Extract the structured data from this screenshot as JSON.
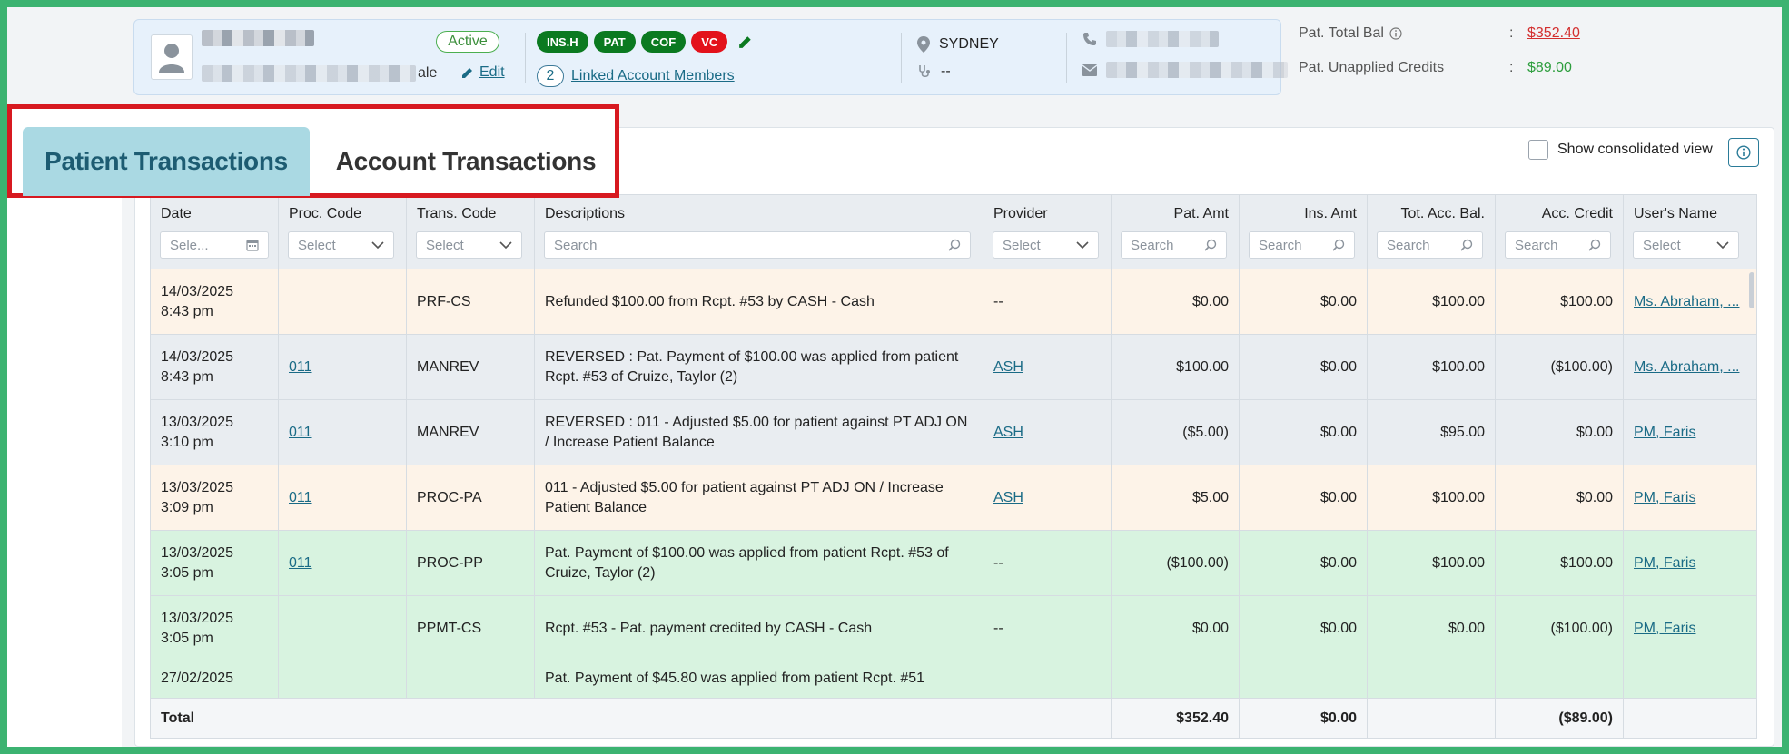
{
  "header": {
    "status": "Active",
    "gender_suffix": "ale",
    "edit_label": "Edit",
    "tags": [
      {
        "label": "INS.H",
        "color": "#0b7a20"
      },
      {
        "label": "PAT",
        "color": "#0b7a20"
      },
      {
        "label": "COF",
        "color": "#0b7a20"
      },
      {
        "label": "VC",
        "color": "#e3121b"
      }
    ],
    "linked_count": "2",
    "linked_label": "Linked Account Members",
    "location": "SYDNEY",
    "doctor": "--",
    "pat_total_bal_label": "Pat. Total Bal",
    "pat_total_bal_value": "$352.40",
    "pat_unapplied_label": "Pat. Unapplied Credits",
    "pat_unapplied_value": "$89.00",
    "colon": ":",
    "colors": {
      "balance_red": "#d32f2f",
      "balance_green": "#2e9e3e",
      "accent": "#1a6b86"
    }
  },
  "tabs": {
    "patient": "Patient Transactions",
    "account": "Account Transactions"
  },
  "consolidated_label": "Show consolidated view",
  "table": {
    "columns": [
      {
        "label": "Date",
        "filter": "Sele..."
      },
      {
        "label": "Proc. Code",
        "filter": "Select"
      },
      {
        "label": "Trans. Code",
        "filter": "Select"
      },
      {
        "label": "Descriptions",
        "filter": "Search"
      },
      {
        "label": "Provider",
        "filter": "Select"
      },
      {
        "label": "Pat. Amt",
        "filter": "Search"
      },
      {
        "label": "Ins. Amt",
        "filter": "Search"
      },
      {
        "label": "Tot. Acc. Bal.",
        "filter": "Search"
      },
      {
        "label": "Acc. Credit",
        "filter": "Search"
      },
      {
        "label": "User's Name",
        "filter": "Select"
      }
    ],
    "rows": [
      {
        "date": "14/03/2025",
        "time": "8:43 pm",
        "proc": "",
        "trans": "PRF-CS",
        "desc": "Refunded $100.00 from Rcpt. #53 by CASH - Cash",
        "provider": "--",
        "pat": "$0.00",
        "ins": "$0.00",
        "tot": "$100.00",
        "credit": "$100.00",
        "user": "Ms. Abraham, ..."
      },
      {
        "date": "14/03/2025",
        "time": "8:43 pm",
        "proc": "011",
        "trans": "MANREV",
        "desc": "REVERSED : Pat. Payment of $100.00 was applied from patient Rcpt. #53 of Cruize, Taylor (2)",
        "provider": "ASH",
        "pat": "$100.00",
        "ins": "$0.00",
        "tot": "$100.00",
        "credit": "($100.00)",
        "user": "Ms. Abraham, ..."
      },
      {
        "date": "13/03/2025",
        "time": "3:10 pm",
        "proc": "011",
        "trans": "MANREV",
        "desc": "REVERSED : 011 - Adjusted $5.00 for patient against PT ADJ ON / Increase Patient Balance",
        "provider": "ASH",
        "pat": "($5.00)",
        "ins": "$0.00",
        "tot": "$95.00",
        "credit": "$0.00",
        "user": "PM, Faris"
      },
      {
        "date": "13/03/2025",
        "time": "3:09 pm",
        "proc": "011",
        "trans": "PROC-PA",
        "desc": "011 - Adjusted $5.00 for patient against PT ADJ ON / Increase Patient Balance",
        "provider": "ASH",
        "pat": "$5.00",
        "ins": "$0.00",
        "tot": "$100.00",
        "credit": "$0.00",
        "user": "PM, Faris"
      },
      {
        "date": "13/03/2025",
        "time": "3:05 pm",
        "proc": "011",
        "trans": "PROC-PP",
        "desc": "Pat. Payment of $100.00 was applied from patient Rcpt. #53 of Cruize, Taylor (2)",
        "provider": "--",
        "pat": "($100.00)",
        "ins": "$0.00",
        "tot": "$100.00",
        "credit": "$100.00",
        "user": "PM, Faris"
      },
      {
        "date": "13/03/2025",
        "time": "3:05 pm",
        "proc": "",
        "trans": "PPMT-CS",
        "desc": "Rcpt. #53 - Pat. payment credited by CASH - Cash",
        "provider": "--",
        "pat": "$0.00",
        "ins": "$0.00",
        "tot": "$0.00",
        "credit": "($100.00)",
        "user": "PM, Faris"
      },
      {
        "date": "27/02/2025",
        "time": "",
        "proc": "",
        "trans": "",
        "desc": "Pat. Payment of $45.80 was applied from patient Rcpt. #51",
        "provider": "",
        "pat": "",
        "ins": "",
        "tot": "",
        "credit": "",
        "user": ""
      }
    ],
    "row_colors": [
      "#fdf3e8",
      "#e9edf1",
      "#e9edf1",
      "#fdf3e8",
      "#d8f3e0",
      "#d8f3e0",
      "#d8f3e0"
    ],
    "footer": {
      "label": "Total",
      "pat": "$352.40",
      "ins": "$0.00",
      "credit": "($89.00)"
    }
  }
}
